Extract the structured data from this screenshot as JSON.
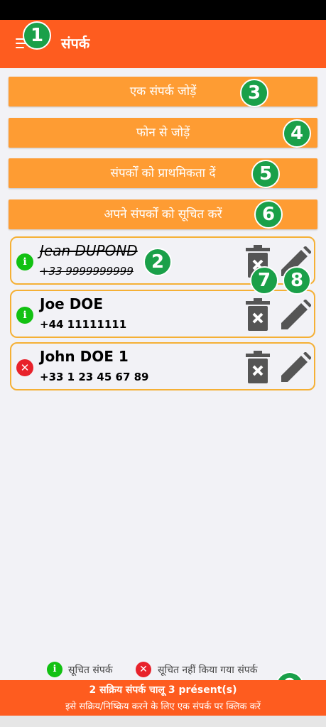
{
  "app": {
    "title": "संपर्क"
  },
  "actions": {
    "add_contact": "एक संपर्क जोड़ें",
    "add_from_phone": "फोन से जोड़ें",
    "prioritize_contacts": "संपर्कों को प्राथमिकता दें",
    "notify_contacts": "अपने संपर्कों को सूचित करें"
  },
  "contacts": [
    {
      "name": "Jean DUPOND",
      "phone": "+33 9999999999",
      "status": "informed",
      "active": false
    },
    {
      "name": "Joe DOE",
      "phone": "+44 11111111",
      "status": "informed",
      "active": true
    },
    {
      "name": "John DOE 1",
      "phone": "+33 1 23 45 67 89",
      "status": "not-informed",
      "active": true
    }
  ],
  "legend": {
    "informed_label": "सूचित संपर्क",
    "not_informed_label": "सूचित नहीं किया गया संपर्क"
  },
  "footer": {
    "summary": "2 सक्रिय संपर्क चालू 3 présent(s)",
    "hint": "इसे सक्रिय/निष्क्रिय करने के लिए एक संपर्क पर क्लिक करें"
  },
  "annotations": [
    "1",
    "2",
    "3",
    "4",
    "5",
    "6",
    "7",
    "8",
    "9"
  ],
  "colors": {
    "appbar": "#fe5c1f",
    "button": "#fe9c33",
    "card_border": "#f5b035",
    "informed": "#12c112",
    "not_informed": "#e8222b",
    "badge": "#1aa049",
    "icon": "#555555"
  },
  "icons": {
    "menu": "menu-icon",
    "delete": "trash-delete-icon",
    "edit": "pencil-edit-icon",
    "informed": "info-icon",
    "not_informed": "close-icon"
  }
}
